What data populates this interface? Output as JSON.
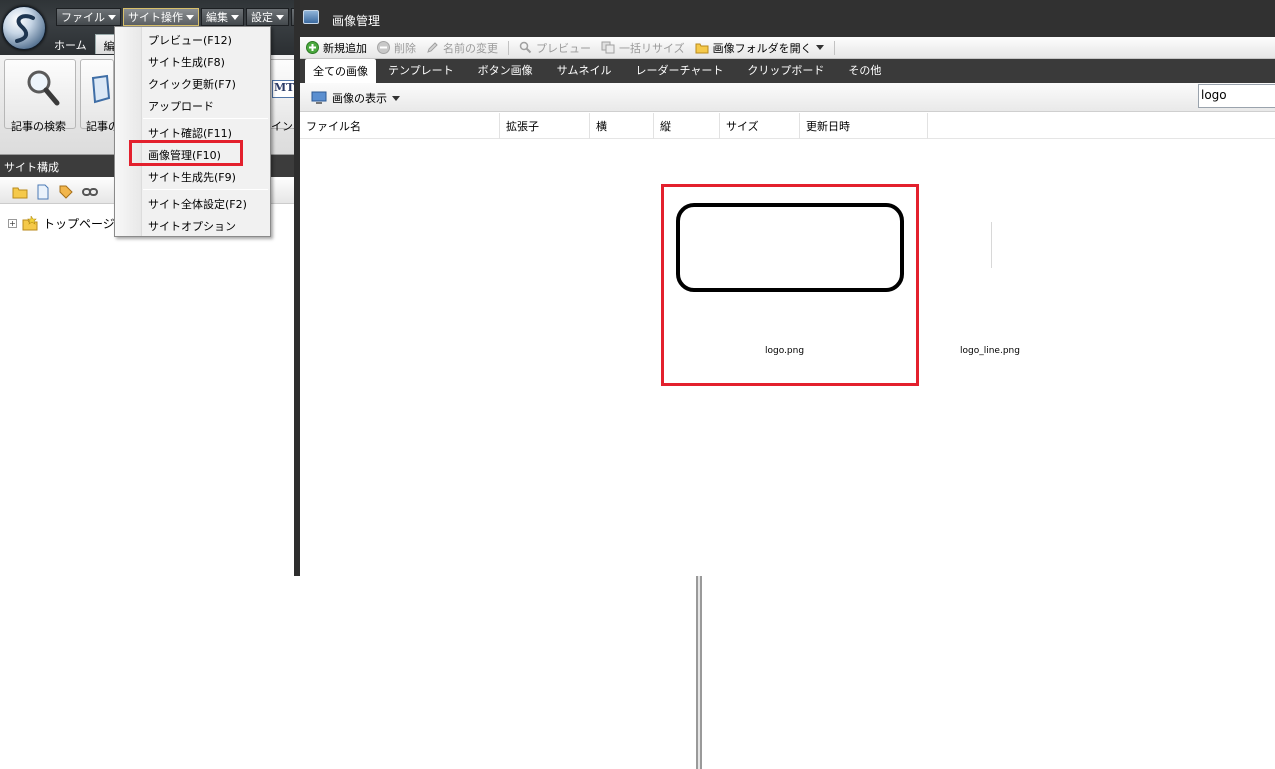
{
  "main_window": {
    "menubar": [
      {
        "label": "ファイル"
      },
      {
        "label": "サイト操作"
      },
      {
        "label": "編集"
      },
      {
        "label": "設定"
      },
      {
        "label": "S"
      }
    ],
    "ribbon_tabs": [
      {
        "label": "ホーム"
      },
      {
        "label": "編"
      }
    ],
    "ribbon_buttons": {
      "search": "記事の検索",
      "article": "記事の",
      "mt": "インポ"
    },
    "mt_logo": "MT",
    "site_panel_title": "サイト構成",
    "tree": {
      "expander": "+",
      "root_label": "トップページ"
    }
  },
  "site_menu": {
    "items": [
      {
        "label": "プレビュー(F12)"
      },
      {
        "label": "サイト生成(F8)"
      },
      {
        "label": "クイック更新(F7)"
      },
      {
        "label": "アップロード"
      },
      {
        "label": "サイト確認(F11)"
      },
      {
        "label": "画像管理(F10)"
      },
      {
        "label": "サイト生成先(F9)"
      },
      {
        "label": "サイト全体設定(F2)"
      },
      {
        "label": "サイトオプション"
      }
    ],
    "highlighted": "画像管理(F10)"
  },
  "image_manager": {
    "title": "画像管理",
    "toolbar": {
      "add": "新規追加",
      "delete": "削除",
      "rename": "名前の変更",
      "preview": "プレビュー",
      "resize": "一括リサイズ",
      "open_folder": "画像フォルダを開く"
    },
    "tabs": [
      {
        "label": "全ての画像"
      },
      {
        "label": "テンプレート"
      },
      {
        "label": "ボタン画像"
      },
      {
        "label": "サムネイル"
      },
      {
        "label": "レーダーチャート"
      },
      {
        "label": "クリップボード"
      },
      {
        "label": "その他"
      }
    ],
    "view_button": "画像の表示",
    "search_value": "logo",
    "columns": [
      {
        "label": "ファイル名"
      },
      {
        "label": "拡張子"
      },
      {
        "label": "横"
      },
      {
        "label": "縦"
      },
      {
        "label": "サイズ"
      },
      {
        "label": "更新日時"
      }
    ],
    "images": [
      {
        "filename": "logo.png"
      },
      {
        "filename": "logo_line.png"
      }
    ]
  },
  "colors": {
    "highlight": "#e3202d",
    "titlebar": "#313131",
    "tabbar": "#3a3a3a"
  }
}
